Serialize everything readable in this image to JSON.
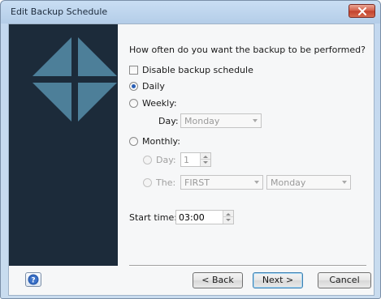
{
  "window": {
    "title": "Edit Backup Schedule"
  },
  "question": "How often do you want the backup to be performed?",
  "disable_schedule": {
    "label": "Disable backup schedule",
    "checked": false
  },
  "frequency": {
    "daily_label": "Daily",
    "weekly_label": "Weekly:",
    "monthly_label": "Monthly:",
    "selected": "Daily"
  },
  "weekly": {
    "day_label": "Day:",
    "day_value": "Monday"
  },
  "monthly": {
    "day_label": "Day:",
    "day_value": "1",
    "the_label": "The:",
    "ordinal_value": "FIRST",
    "weekday_value": "Monday"
  },
  "start_time": {
    "label": "Start time:",
    "value": "03:00"
  },
  "buttons": {
    "back": "< Back",
    "next": "Next >",
    "cancel": "Cancel"
  },
  "icons": {
    "close": "close-icon",
    "help": "help-icon",
    "banner": "diamond-cross-logo"
  },
  "colors": {
    "banner_bg": "#1c2b3a",
    "banner_shape": "#4d7f99",
    "title_bar": "#c9def3",
    "close_button": "#c2402c"
  }
}
